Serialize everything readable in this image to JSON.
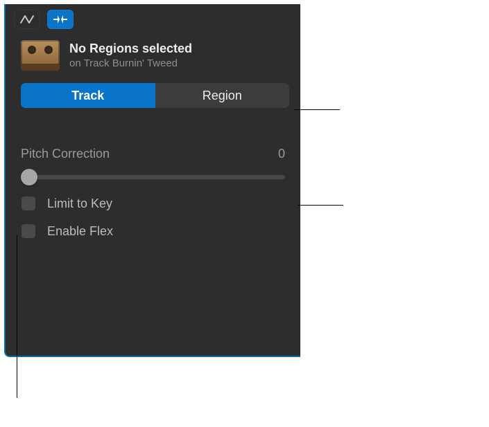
{
  "header": {
    "title": "No Regions selected",
    "subtitle": "on Track Burnin' Tweed"
  },
  "segmented": {
    "track": "Track",
    "region": "Region"
  },
  "pitch": {
    "label": "Pitch Correction",
    "value": "0"
  },
  "checks": {
    "limit": "Limit to Key",
    "flex": "Enable Flex"
  }
}
